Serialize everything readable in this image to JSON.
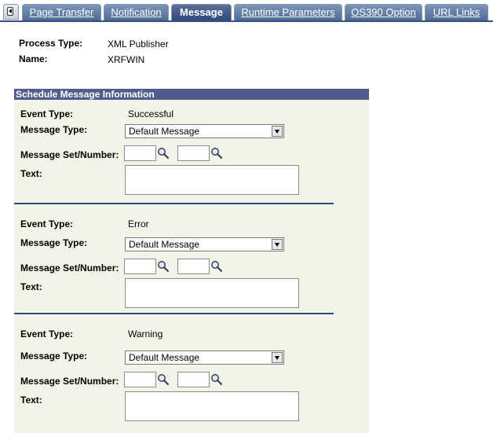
{
  "tabs": [
    {
      "label": "Page Transfer",
      "active": false
    },
    {
      "label": "Notification",
      "active": false
    },
    {
      "label": "Message",
      "active": true
    },
    {
      "label": "Runtime Parameters",
      "active": false
    },
    {
      "label": "OS390 Option",
      "active": false
    },
    {
      "label": "URL Links",
      "active": false
    }
  ],
  "header": {
    "process_type_label": "Process Type:",
    "process_type_value": "XML Publisher",
    "name_label": "Name:",
    "name_value": "XRFWIN"
  },
  "group": {
    "title": "Schedule Message Information",
    "event_type_label": "Event Type:",
    "message_type_label": "Message Type:",
    "message_set_label": "Message Set/Number:",
    "text_label": "Text:",
    "events": [
      {
        "event_type": "Successful",
        "message_type": "Default Message"
      },
      {
        "event_type": "Error",
        "message_type": "Default Message"
      },
      {
        "event_type": "Warning",
        "message_type": "Default Message"
      }
    ]
  },
  "icons": {
    "tab_scroll": "scroll-left-icon",
    "lookup": "magnifier-lookup-icon"
  }
}
